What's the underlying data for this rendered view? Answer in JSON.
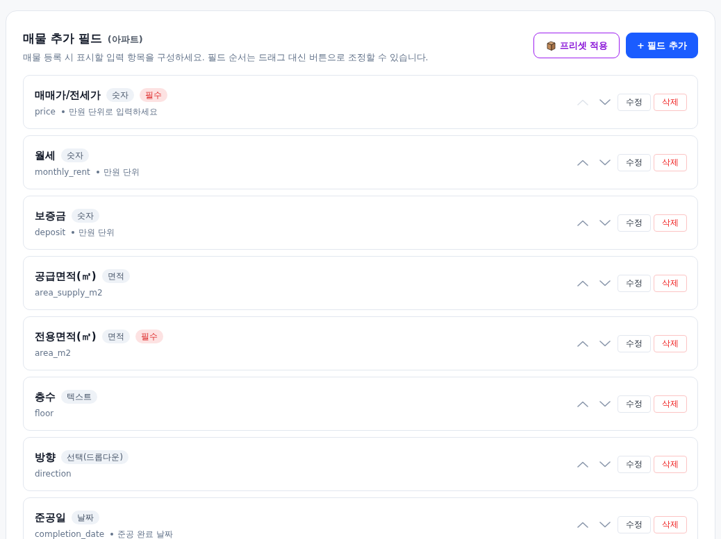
{
  "header": {
    "title": "매물 추가 필드",
    "subtitle": "(아파트)",
    "description": "매물 등록 시 표시할 입력 항목을 구성하세요. 필드 순서는 드래그 대신 버튼으로 조정할 수 있습니다.",
    "buttons": [
      {
        "kind": "preset",
        "label": "프리셋 적용"
      },
      {
        "kind": "add",
        "label": "+ 필드 추가"
      }
    ]
  },
  "fields": [
    {
      "name": "매매가/전세가",
      "badges": [
        {
          "kind": "type",
          "label": "숫자"
        },
        {
          "kind": "required",
          "label": "필수"
        }
      ],
      "key": "price",
      "hint": "만원 단위로 입력하세요",
      "up_disabled": true,
      "down_disabled": false,
      "edit_label": "수정",
      "delete_label": "삭제"
    },
    {
      "name": "월세",
      "badges": [
        {
          "kind": "type",
          "label": "숫자"
        }
      ],
      "key": "monthly_rent",
      "hint": "만원 단위",
      "up_disabled": false,
      "down_disabled": false,
      "edit_label": "수정",
      "delete_label": "삭제"
    },
    {
      "name": "보증금",
      "badges": [
        {
          "kind": "type",
          "label": "숫자"
        }
      ],
      "key": "deposit",
      "hint": "만원 단위",
      "up_disabled": false,
      "down_disabled": false,
      "edit_label": "수정",
      "delete_label": "삭제"
    },
    {
      "name": "공급면적(㎡)",
      "badges": [
        {
          "kind": "type",
          "label": "면적"
        }
      ],
      "key": "area_supply_m2",
      "up_disabled": false,
      "down_disabled": false,
      "edit_label": "수정",
      "delete_label": "삭제"
    },
    {
      "name": "전용면적(㎡)",
      "badges": [
        {
          "kind": "type",
          "label": "면적"
        },
        {
          "kind": "required",
          "label": "필수"
        }
      ],
      "key": "area_m2",
      "up_disabled": false,
      "down_disabled": false,
      "edit_label": "수정",
      "delete_label": "삭제"
    },
    {
      "name": "층수",
      "badges": [
        {
          "kind": "type",
          "label": "텍스트"
        }
      ],
      "key": "floor",
      "up_disabled": false,
      "down_disabled": false,
      "edit_label": "수정",
      "delete_label": "삭제"
    },
    {
      "name": "방향",
      "badges": [
        {
          "kind": "type",
          "label": "선택(드롭다운)"
        }
      ],
      "key": "direction",
      "up_disabled": false,
      "down_disabled": false,
      "edit_label": "수정",
      "delete_label": "삭제"
    },
    {
      "name": "준공일",
      "badges": [
        {
          "kind": "type",
          "label": "날짜"
        }
      ],
      "key": "completion_date",
      "hint": "준공 완료 날짜",
      "up_disabled": false,
      "down_disabled": false,
      "edit_label": "수정",
      "delete_label": "삭제"
    }
  ]
}
